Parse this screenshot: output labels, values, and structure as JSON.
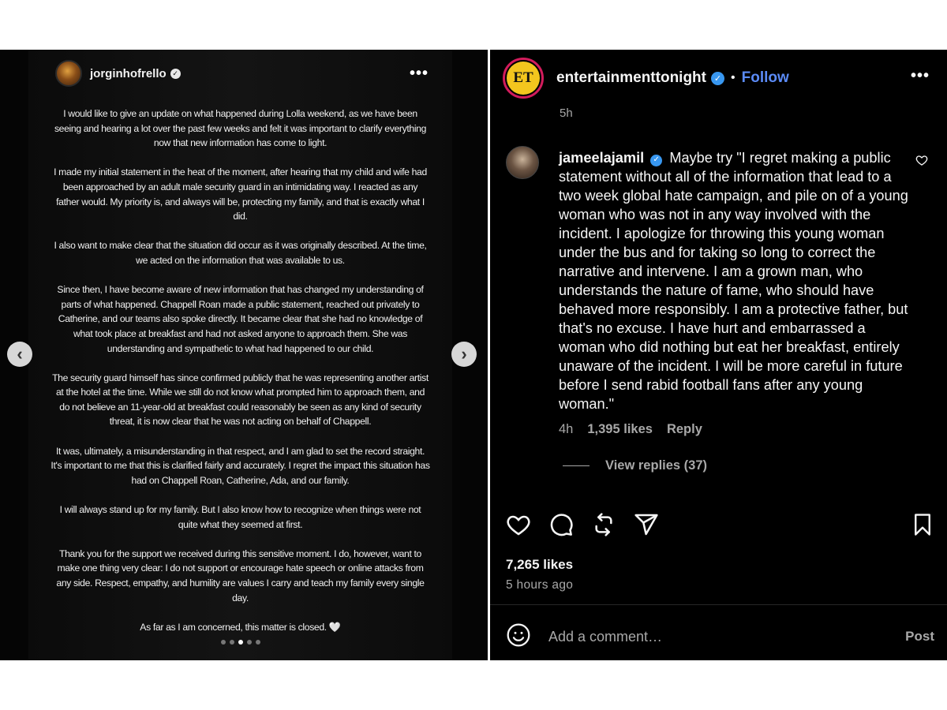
{
  "story": {
    "username": "jorginhofrello",
    "paragraphs": [
      "I would like to give an update on what happened during Lolla weekend, as we have been seeing and hearing a lot over the past few weeks and felt it was important to clarify everything now that new information has come to light.",
      "I made my initial statement in the heat of the moment, after hearing that my child and wife had been approached by an adult male security guard in an intimidating way. I reacted as any father would. My priority is, and always will be, protecting my family, and that is exactly what I did.",
      "I also want to make clear that the situation did occur as it was originally described. At the time, we acted on the information that was available to us.",
      "Since then, I have become aware of new information that has changed my understanding of parts of what happened. Chappell Roan made a public statement, reached out privately to Catherine, and our teams also spoke directly. It became clear that she had no knowledge of what took place at breakfast and had not asked anyone to approach them. She was understanding and sympathetic to what had happened to our child.",
      "The security guard himself has since confirmed publicly that he was representing another artist at the hotel at the time. While we still do not know what prompted him to approach them, and do not believe an 11-year-old at breakfast could reasonably be seen as any kind of security threat, it is now clear that he was not acting on behalf of Chappell.",
      "It was, ultimately, a misunderstanding in that respect, and I am glad to set the record straight. It's important to me that this is clarified fairly and accurately. I regret the impact this situation has had on Chappell Roan, Catherine, Ada, and our family.",
      "I will always stand up for my family. But I also know how to recognize when things were not quite what they seemed at first.",
      "Thank you for the support we received during this sensitive moment. I do, however, want to make one thing very clear: I do not support or encourage hate speech or online attacks from any side. Respect, empathy, and humility are values I carry and teach my family every single day.",
      "As far as I am concerned, this matter is closed. 🤍"
    ],
    "dots": 5,
    "active_dot": 2
  },
  "post": {
    "username": "entertainmenttonight",
    "logo_text": "ET",
    "follow_label": "Follow",
    "time_partial": "5h",
    "comment": {
      "username": "jameelajamil",
      "text": "Maybe try \"I regret making a public statement without all of the information that lead to a two week global hate campaign, and pile on of a young woman who was not in any way involved with the incident. I apologize for throwing this young woman under the bus and for taking so long to correct the narrative and intervene. I am a grown man, who understands the nature of fame, who should have behaved more responsibly. I am a protective father, but that's no excuse. I have hurt and embarrassed a woman who did nothing but eat her breakfast, entirely unaware of the incident. I will be more careful in future before I send rabid football fans after any young woman.\"",
      "time": "4h",
      "likes": "1,395 likes",
      "reply_label": "Reply",
      "view_replies": "View replies (37)"
    },
    "likes": "7,265 likes",
    "posted": "5 hours ago",
    "comment_placeholder": "Add a comment…",
    "post_label": "Post"
  },
  "colors": {
    "follow": "#5b8bf7",
    "verified": "#3897f0",
    "et_ring": "#d21c5c",
    "et_fill": "#f3c61e"
  }
}
